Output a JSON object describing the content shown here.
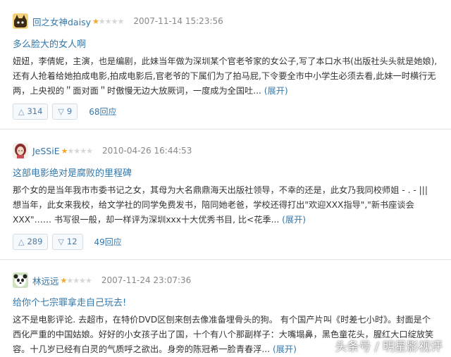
{
  "reviews": [
    {
      "author": "回之女神daisy",
      "rating": 1,
      "date": "2007-11-14 15:23:56",
      "title": "多么脸大的女人啊",
      "body": "妞妞，李倩妮，主演，也是编剧，此妹当年做为深圳某个官老爷家的女公子,写了本口水书(出版社头头就是她娘),还有人抢着给她拍成电影,拍成电影后,官老爷的下属们为了拍马屁,下令要全市中小学生必须去看,此妹一时横行无两，上央视的＂面对面＂时傲慢无边大放厥词，一度成为全国吐...",
      "expand_label": "(展开)",
      "useful_count": "314",
      "useless_count": "9",
      "replies_label": "68回应"
    },
    {
      "author": "JeSSiE",
      "rating": 1,
      "date": "2010-04-26 16:44:53",
      "title": "这部电影绝对是腐败的里程碑",
      "body": "那个女的是当年我市市委书记之女，其母为大名鼎鼎海天出版社领导，不幸的还是，此女乃我同校师姐 - . - ||| 想当年，此女来我校，给文学社的同学免费发书，陪同她老爸，学校还得打出\"欢迎XXX指导\",\"新书座谈会XXX\"…… 书写很一般，却一样评为深圳xxx十大优秀书目, 比<花季...",
      "expand_label": "(展开)",
      "useful_count": "289",
      "useless_count": "12",
      "replies_label": "49回应"
    },
    {
      "author": "林远远",
      "rating": 1,
      "date": "2007-11-24 23:07:36",
      "title": "给你个七宗罪拿走自己玩去!",
      "body": "这不是电影评论. 去超市，在特价DVD区刨来刨去像准备埋骨头的狗。 有个国产片叫《时差七小时》。封面是个西化严重的中国姑娘。好好的小女孩子出了国，十个有八个那副样子：大嘴塌鼻，黑色童花头，腥红大口绽放笑容。十几岁已经有白灵的气质呼之欲出。身旁的陈冠希一脸青春浮...",
      "expand_label": "(展开)"
    }
  ],
  "watermark": "头条号 / 明星影视评"
}
